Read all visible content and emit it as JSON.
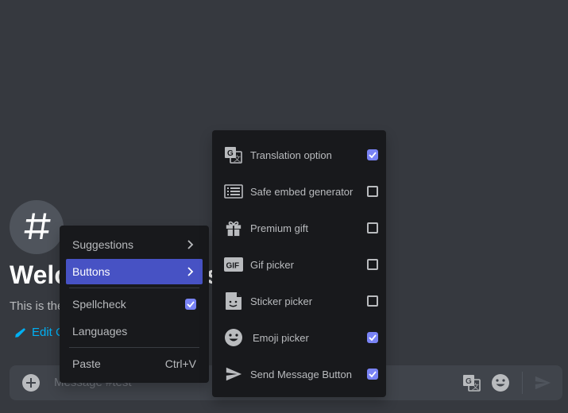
{
  "channel": {
    "welcome_title": "Welc",
    "welcome_title_tail": "s",
    "welcome_sub": "This is the",
    "edit_link": "Edit C"
  },
  "composer": {
    "placeholder": "Message #test"
  },
  "context_menu": {
    "items": [
      {
        "label": "Suggestions",
        "has_submenu": true
      },
      {
        "label": "Buttons",
        "has_submenu": true,
        "active": true
      },
      {
        "label": "Spellcheck",
        "checked": true
      },
      {
        "label": "Languages"
      },
      {
        "label": "Paste",
        "shortcut": "Ctrl+V"
      }
    ]
  },
  "buttons_submenu": {
    "items": [
      {
        "label": "Translation option",
        "icon": "translate-icon",
        "checked": true
      },
      {
        "label": "Safe embed generator",
        "icon": "embed-icon",
        "checked": false
      },
      {
        "label": "Premium gift",
        "icon": "gift-icon",
        "checked": false
      },
      {
        "label": "Gif picker",
        "icon": "gif-icon",
        "checked": false
      },
      {
        "label": "Sticker picker",
        "icon": "sticker-icon",
        "checked": false
      },
      {
        "label": "Emoji picker",
        "icon": "emoji-icon",
        "checked": true
      },
      {
        "label": "Send Message Button",
        "icon": "send-icon",
        "checked": true
      }
    ]
  },
  "colors": {
    "background": "#36393f",
    "menu_bg": "#18191c",
    "accent": "#4752c4",
    "checkbox_checked": "#7983f5",
    "link": "#00b0f4"
  }
}
